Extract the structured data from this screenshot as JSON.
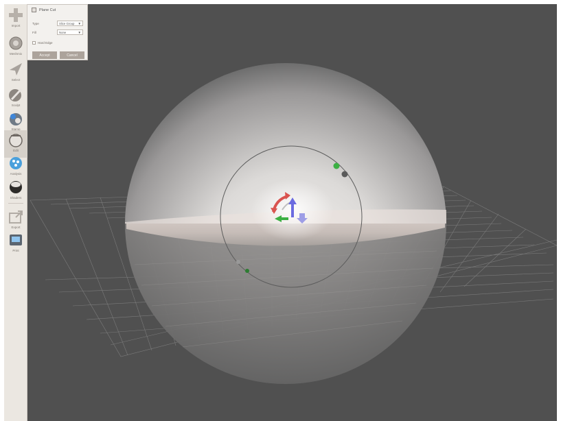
{
  "toolbar": {
    "items": [
      {
        "label": "Import"
      },
      {
        "label": "Meshmix"
      },
      {
        "label": "Select"
      },
      {
        "label": "Sculpt"
      },
      {
        "label": "Stamp"
      },
      {
        "label": "Edit"
      },
      {
        "label": "Analysis"
      },
      {
        "label": "Shaders"
      },
      {
        "label": "Export"
      },
      {
        "label": "Print"
      }
    ]
  },
  "panel": {
    "title": "Plane Cut",
    "type_label": "Type",
    "type_value": "Slice Group",
    "fill_label": "Fill",
    "fill_value": "None",
    "hard_edge_label": "Hard Edge",
    "accept_label": "Accept",
    "cancel_label": "Cancel"
  },
  "colors": {
    "viewport_bg": "#505050",
    "toolbar_bg": "#ebe7e1",
    "panel_bg": "#f3f1ee",
    "button": "#aca39b",
    "gizmo_green": "#3cb043",
    "gizmo_red": "#d9534f",
    "gizmo_blue": "#8a8ae6"
  }
}
